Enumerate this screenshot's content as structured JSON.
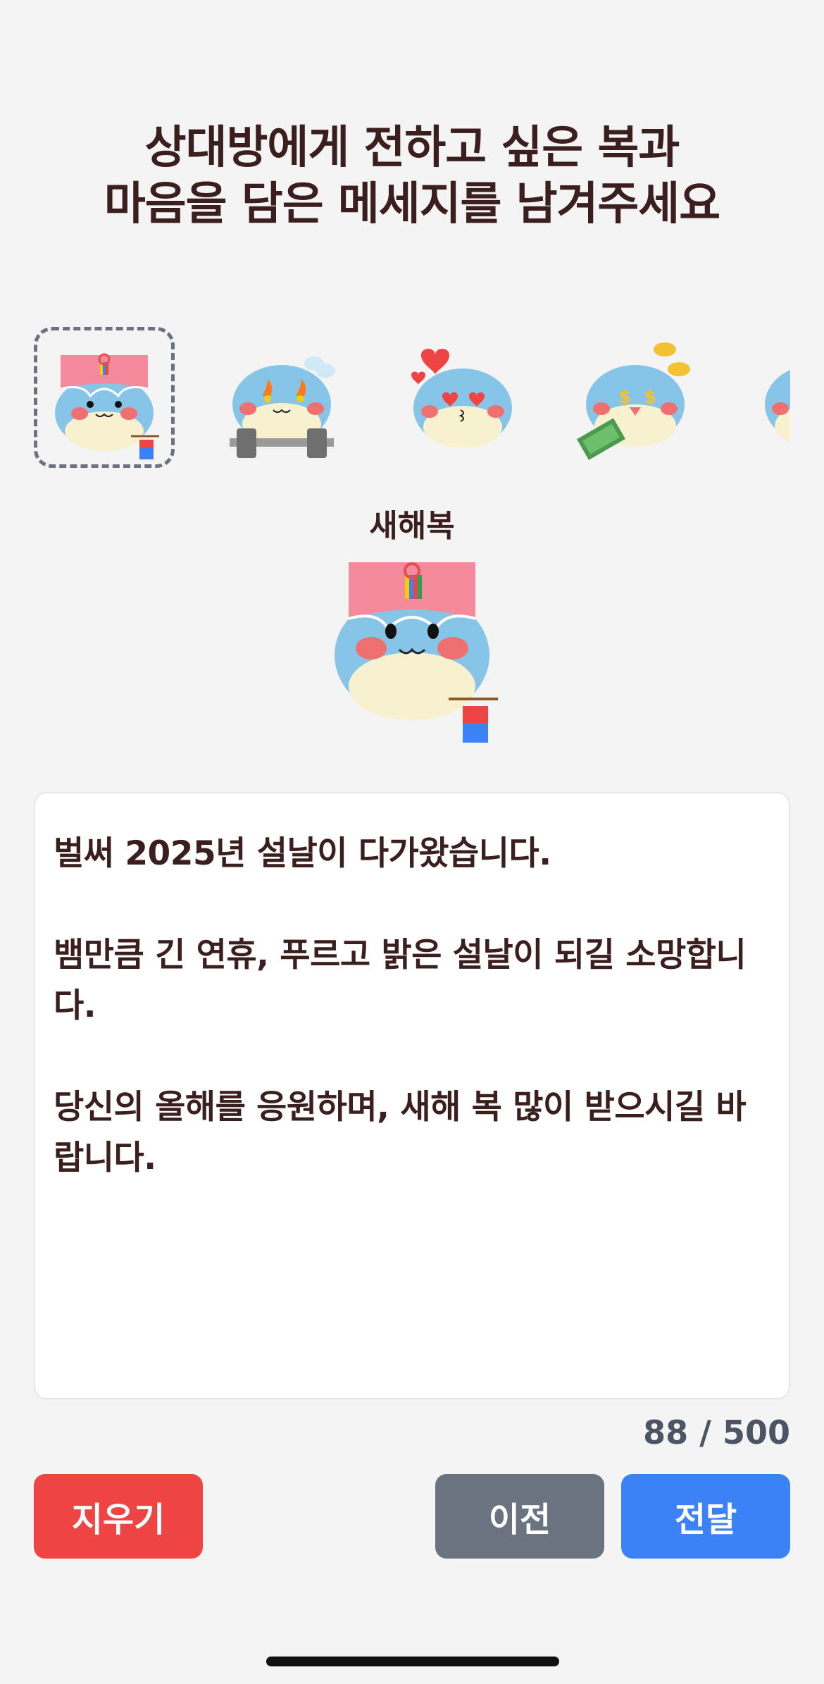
{
  "header": {
    "title_line1": "상대방에게 전하고 싶은 복과",
    "title_line2": "마음을 담은 메세지를 남겨주세요"
  },
  "stickers": [
    {
      "name": "new-year-sticker",
      "selected": true
    },
    {
      "name": "workout-sticker",
      "selected": false
    },
    {
      "name": "love-sticker",
      "selected": false
    },
    {
      "name": "money-sticker",
      "selected": false
    },
    {
      "name": "partial-sticker",
      "selected": false
    }
  ],
  "selected_sticker": {
    "label": "새해복"
  },
  "message": {
    "text": "벌써 2025년 설날이 다가왔습니다.\n\n뱀만큼 긴 연휴, 푸르고 밝은 설날이 되길 소망합니다.\n\n당신의 올해를 응원하며, 새해 복 많이 받으시길 바랍니다."
  },
  "counter": {
    "text": "88 / 500"
  },
  "buttons": {
    "clear": "지우기",
    "prev": "이전",
    "send": "전달"
  },
  "colors": {
    "clear": "#ef4444",
    "prev": "#6b7280",
    "send": "#3b82f6",
    "title": "#3b1e1e"
  }
}
